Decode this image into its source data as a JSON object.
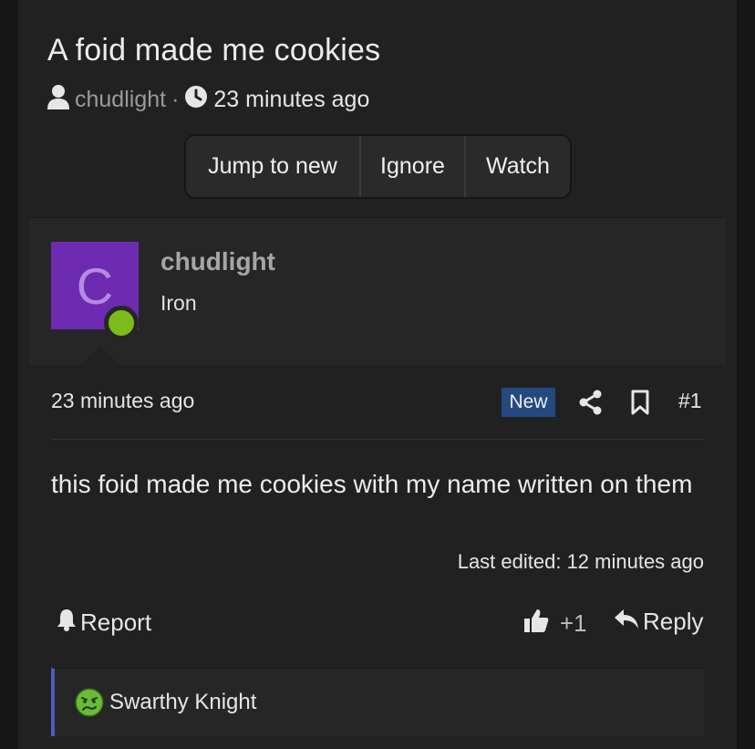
{
  "thread": {
    "title": "A foid made me cookies",
    "author": "chudlight",
    "separator": "·",
    "time_ago": "23 minutes ago"
  },
  "thread_actions": {
    "jump": "Jump to new",
    "ignore": "Ignore",
    "watch": "Watch"
  },
  "post": {
    "avatar_letter": "C",
    "avatar_color": "#6c2bb0",
    "online_color": "#7dbb1b",
    "username": "chudlight",
    "rank": "Iron",
    "time_ago": "23 minutes ago",
    "badge": "New",
    "badge_color": "#24497e",
    "number": "#1",
    "body": "this foid made me cookies with my name written on them",
    "last_edited": "Last edited: 12 minutes ago"
  },
  "post_actions": {
    "report": "Report",
    "like_count": "+1",
    "reply": "Reply"
  },
  "reactions": {
    "reactor": "Swarthy Knight",
    "emoji_icon": "sick-face-icon",
    "bar_color": "#4d5bbf"
  }
}
